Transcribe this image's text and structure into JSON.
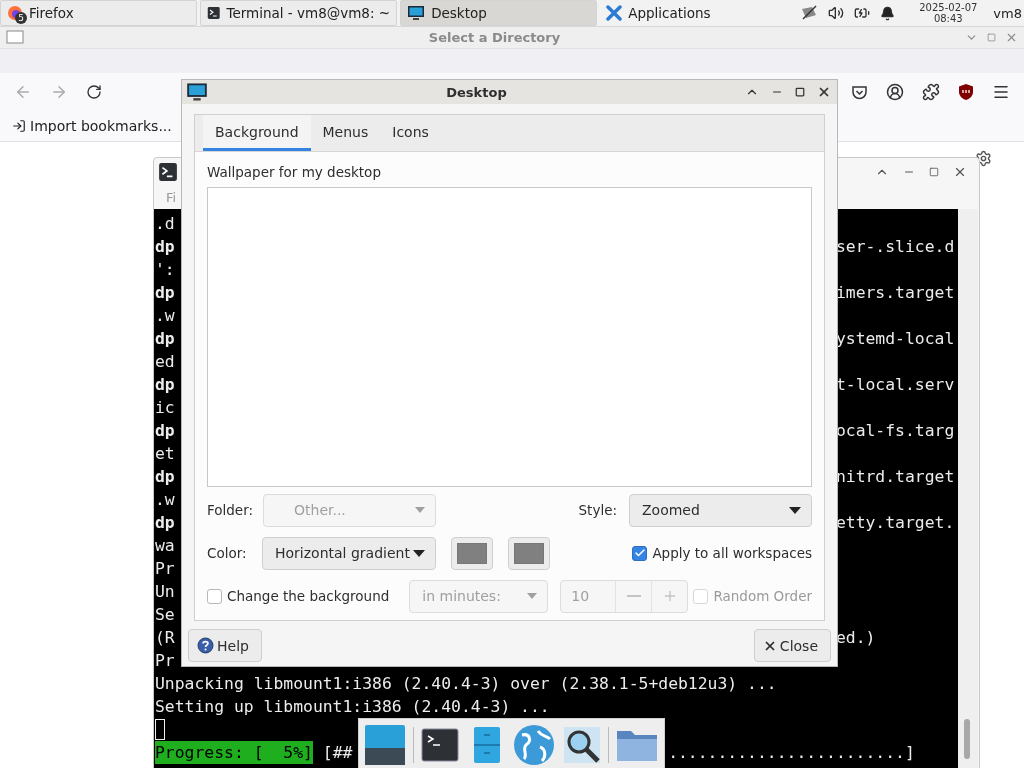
{
  "panel": {
    "tasks": [
      {
        "kind": "firefox",
        "label": "Firefox",
        "badge": "5",
        "selected": false
      },
      {
        "kind": "terminal",
        "label": "Terminal - vm8@vm8: ~",
        "selected": false
      },
      {
        "kind": "desktop",
        "label": "Desktop",
        "selected": true
      },
      {
        "kind": "applications",
        "label": "Applications",
        "selected": false
      }
    ],
    "date": "2025-02-07",
    "time": "08:43",
    "user": "vm8"
  },
  "file_chooser": {
    "title": "Select a Directory"
  },
  "browser": {
    "bookmarks": [
      {
        "label": "Import bookmarks..."
      }
    ]
  },
  "terminal": {
    "menu": "Fi",
    "rows": [
      {
        "kind": "text",
        "left": ".d",
        "bold": false
      },
      {
        "kind": "text",
        "left": "dp",
        "bold": true,
        "right": "ser-.slice.d"
      },
      {
        "kind": "text",
        "left": "':",
        "bold": false
      },
      {
        "kind": "text",
        "left": "dp",
        "bold": true,
        "right": "imers.target"
      },
      {
        "kind": "text",
        "left": ".w",
        "bold": false
      },
      {
        "kind": "text",
        "left": "dp",
        "bold": true,
        "right": "ystemd-local"
      },
      {
        "kind": "text",
        "left": "ed",
        "bold": false
      },
      {
        "kind": "text",
        "left": "dp",
        "bold": true,
        "right": "t-local.serv"
      },
      {
        "kind": "text",
        "left": "ic",
        "bold": false
      },
      {
        "kind": "text",
        "left": "dp",
        "bold": true,
        "right": "ocal-fs.targ"
      },
      {
        "kind": "text",
        "left": "et",
        "bold": false
      },
      {
        "kind": "text",
        "left": "dp",
        "bold": true,
        "right": "nitrd.target"
      },
      {
        "kind": "text",
        "left": ".w",
        "bold": false
      },
      {
        "kind": "text",
        "left": "dp",
        "bold": true,
        "right": "etty.target."
      },
      {
        "kind": "text",
        "left": "wa",
        "bold": false
      },
      {
        "kind": "text",
        "left": "Pr",
        "bold": false
      },
      {
        "kind": "text",
        "left": "Un",
        "bold": false
      },
      {
        "kind": "text",
        "left": "Se",
        "bold": false
      },
      {
        "kind": "text",
        "left": "(R",
        "bold": false,
        "right": "ed.)"
      },
      {
        "kind": "text",
        "left": "Pr",
        "bold": false
      },
      {
        "kind": "text",
        "left": "Unpacking libmount1:i386 (2.40.4-3) over (2.38.1-5+deb12u3) ...",
        "bold": false
      },
      {
        "kind": "text",
        "left": "Setting up libmount1:i386 (2.40.4-3) ...",
        "bold": false
      },
      {
        "kind": "cursor"
      },
      {
        "kind": "progress",
        "label": "Progress: [  5%]",
        "left": " [##",
        "right": "........................]"
      }
    ]
  },
  "dialog": {
    "title": "Desktop",
    "tabs": [
      {
        "label": "Background",
        "selected": true
      },
      {
        "label": "Menus",
        "selected": false
      },
      {
        "label": "Icons",
        "selected": false
      }
    ],
    "wallpaper_label": "Wallpaper for my desktop",
    "folder": {
      "label": "Folder:",
      "value": "Other...",
      "disabled": true
    },
    "style": {
      "label": "Style:",
      "value": "Zoomed",
      "disabled": false
    },
    "color": {
      "label": "Color:",
      "value": "Horizontal gradient",
      "disabled": false,
      "swatches": [
        {
          "color": "#808080"
        },
        {
          "color": "#808080"
        }
      ]
    },
    "apply_all": {
      "label": "Apply to all workspaces",
      "checked": true,
      "disabled": false
    },
    "change_background": {
      "label": "Change the background",
      "checked": false,
      "disabled": false
    },
    "interval": {
      "value": "in minutes:",
      "disabled": true
    },
    "spin": {
      "value": "10",
      "disabled": true
    },
    "random_order": {
      "label": "Random Order",
      "checked": false,
      "disabled": true
    },
    "help": "Help",
    "close": "Close"
  }
}
